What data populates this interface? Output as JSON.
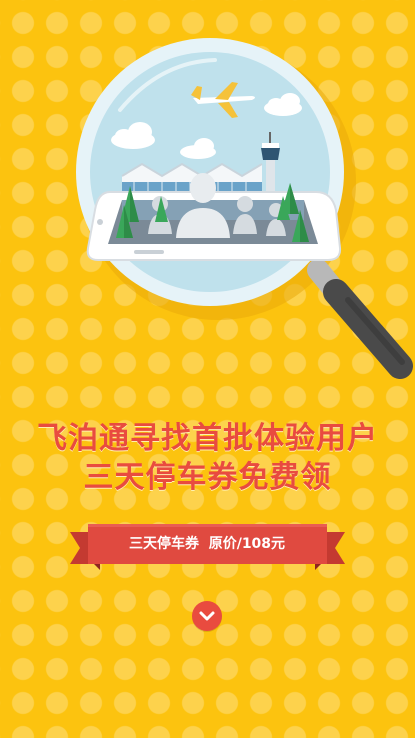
{
  "hero": {
    "illustration": "airport-terminal-under-magnifying-glass",
    "icons": [
      "magnifier-icon",
      "airplane-icon",
      "cloud-icon",
      "control-tower-icon",
      "tree-icon",
      "user-silhouette-icon",
      "phone-icon"
    ]
  },
  "headline": {
    "line1": "飞泊通寻找首批体验用户",
    "line2": "三天停车券免费领"
  },
  "ribbon": {
    "ticket_label": "三天停车券",
    "price_label": "原价/108元"
  },
  "scroll_down": {
    "icon": "chevron-down-icon"
  },
  "colors": {
    "background": "#fcc30f",
    "dots": "#fdd24c",
    "accent": "#e94b3f",
    "ribbon_dark": "#b8322a"
  }
}
